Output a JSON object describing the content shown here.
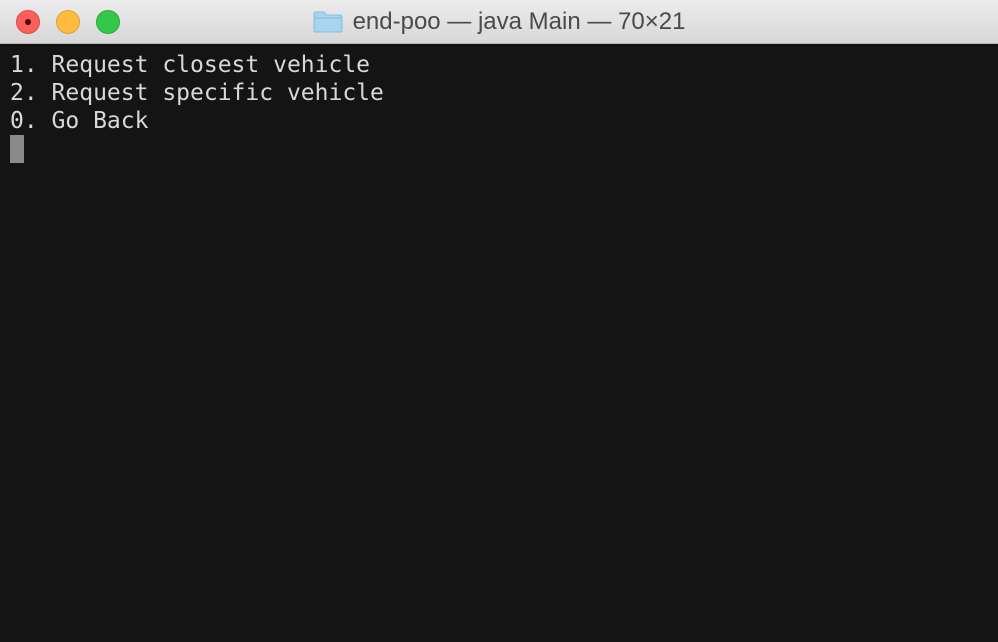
{
  "window": {
    "title": "end-poo — java Main — 70×21",
    "title_icon": "folder-icon",
    "buttons": [
      "close",
      "minimize",
      "zoom"
    ]
  },
  "terminal": {
    "lines": [
      "1. Request closest vehicle",
      "2. Request specific vehicle",
      "0. Go Back"
    ],
    "background": "#141414",
    "foreground": "#d8d8d8",
    "cursor_color": "#8a8a8a"
  },
  "colors": {
    "close": "#fc605c",
    "minimize": "#fdbc40",
    "zoom": "#34c84a",
    "folder": "#a9d4ef"
  }
}
